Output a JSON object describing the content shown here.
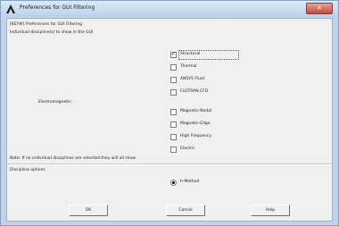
{
  "window": {
    "title": "Preferences for GUI Filtering",
    "logo_icon": "ansys-logo-icon",
    "close_icon": "close-icon",
    "close_glyph": "✕"
  },
  "dialog": {
    "header": "[KEYW] Preferences for GUI Filtering",
    "intro": "Individual discipline(s) to show in the GUI",
    "electromagnetic_label": "Electromagnetic:",
    "note": "Note: If no individual disciplines are selected they will all show."
  },
  "disciplines": [
    {
      "label": "Structural",
      "checked": true
    },
    {
      "label": "Thermal",
      "checked": false
    },
    {
      "label": "ANSYS Fluid",
      "checked": false
    },
    {
      "label": "FLOTRAN CFD",
      "checked": false
    },
    {
      "label": "Magnetic-Nodal",
      "checked": false
    },
    {
      "label": "Magnetic-Edge",
      "checked": false
    },
    {
      "label": "High Frequency",
      "checked": false
    },
    {
      "label": "Electric",
      "checked": false
    }
  ],
  "options": {
    "section_label": "Discipline options",
    "method_label": "h-Method",
    "method_selected": true
  },
  "buttons": {
    "ok": "OK",
    "cancel": "Cancel",
    "help": "Help"
  },
  "colors": {
    "frame": "#bfd3ea",
    "client": "#f0f0f0",
    "close_button": "#c34a37"
  }
}
